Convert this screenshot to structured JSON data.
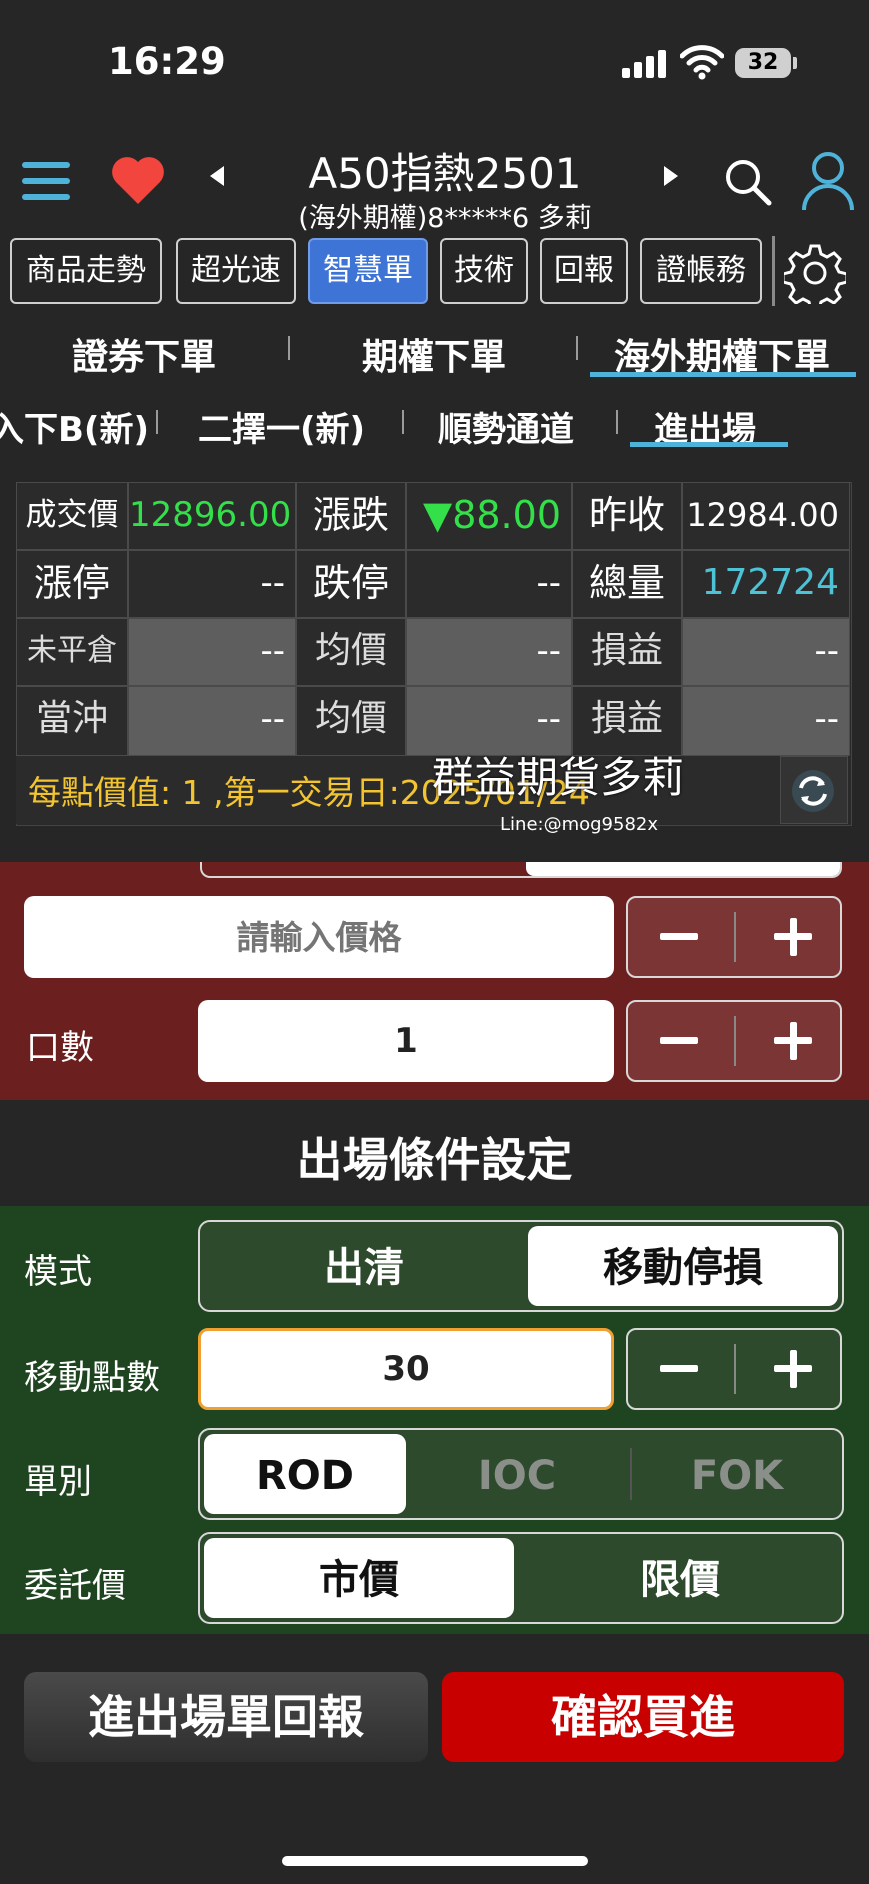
{
  "status": {
    "time": "16:29",
    "battery": "32"
  },
  "header": {
    "title": "A50指熱2501",
    "subtitle": "(海外期權)8*****6  多莉"
  },
  "nav_buttons": [
    "商品走勢",
    "超光速",
    "智慧單",
    "技術",
    "回報",
    "證帳務"
  ],
  "nav_active": "智慧單",
  "tabs_primary": [
    "證券下單",
    "期權下單",
    "海外期權下單"
  ],
  "tabs_primary_active": "海外期權下單",
  "tabs_secondary": [
    "入下B(新)",
    "二擇一(新)",
    "順勢通道",
    "進出場"
  ],
  "tabs_secondary_active": "進出場",
  "quote": {
    "row1": {
      "label1": "成交價",
      "value1": "12896.00",
      "label2": "漲跌",
      "value2": "▼88.00",
      "label3": "昨收",
      "value3": "12984.00"
    },
    "row2": {
      "label1": "漲停",
      "value1": "--",
      "label2": "跌停",
      "value2": "--",
      "label3": "總量",
      "value3": "172724"
    },
    "row3": {
      "label1": "未平倉",
      "value1": "--",
      "label2": "均價",
      "value2": "--",
      "label3": "損益",
      "value3": "--"
    },
    "row4": {
      "label1": "當沖",
      "value1": "--",
      "label2": "均價",
      "value2": "--",
      "label3": "損益",
      "value3": "--"
    },
    "info": "每點價值: 1 ,第一交易日:2025/01/24"
  },
  "watermark": {
    "name": "群益期貨多莉",
    "line": "Line:@mog9582x"
  },
  "entry": {
    "price_placeholder": "請輸入價格",
    "qty_label": "口數",
    "qty_value": "1"
  },
  "exit_title": "出場條件設定",
  "exit": {
    "mode_label": "模式",
    "mode_options": [
      "出清",
      "移動停損"
    ],
    "mode_selected": "移動停損",
    "points_label": "移動點數",
    "points_value": "30",
    "order_type_label": "單別",
    "order_type_options": [
      "ROD",
      "IOC",
      "FOK"
    ],
    "order_type_selected": "ROD",
    "price_type_label": "委託價",
    "price_type_options": [
      "市價",
      "限價"
    ],
    "price_type_selected": "市價"
  },
  "actions": {
    "report": "進出場單回報",
    "confirm": "確認買進"
  },
  "colors": {
    "accent": "#4fb3d9",
    "nav_active": "#3d74d6",
    "up_down_green": "#33e04a",
    "volume_cyan": "#4fc3d6",
    "info_yellow": "#f2c431",
    "buy_red": "#c80000",
    "entry_bg": "#6b1f1f",
    "exit_bg": "#1e4420"
  }
}
